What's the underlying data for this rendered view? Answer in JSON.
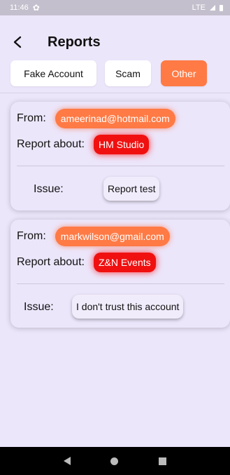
{
  "status_bar": {
    "time": "11:46",
    "network": "LTE"
  },
  "header": {
    "title": "Reports"
  },
  "tabs": [
    {
      "label": "Fake Account",
      "selected": false
    },
    {
      "label": "Scam",
      "selected": false
    },
    {
      "label": "Other",
      "selected": true
    }
  ],
  "labels": {
    "from": "From:",
    "report_about": "Report about:",
    "issue": "Issue:"
  },
  "reports": [
    {
      "from": "ameerinad@hotmail.com",
      "about": "HM Studio",
      "issue": "Report test"
    },
    {
      "from": "markwilson@gmail.com",
      "about": "Z&N Events",
      "issue": "I don't trust this account"
    }
  ],
  "colors": {
    "accent": "#ff7a45",
    "badge_red": "#f01010",
    "background": "#ece6fb"
  },
  "icons": {
    "back": "back-arrow-icon",
    "settings": "gear-icon",
    "signal": "signal-icon",
    "battery": "battery-icon"
  }
}
